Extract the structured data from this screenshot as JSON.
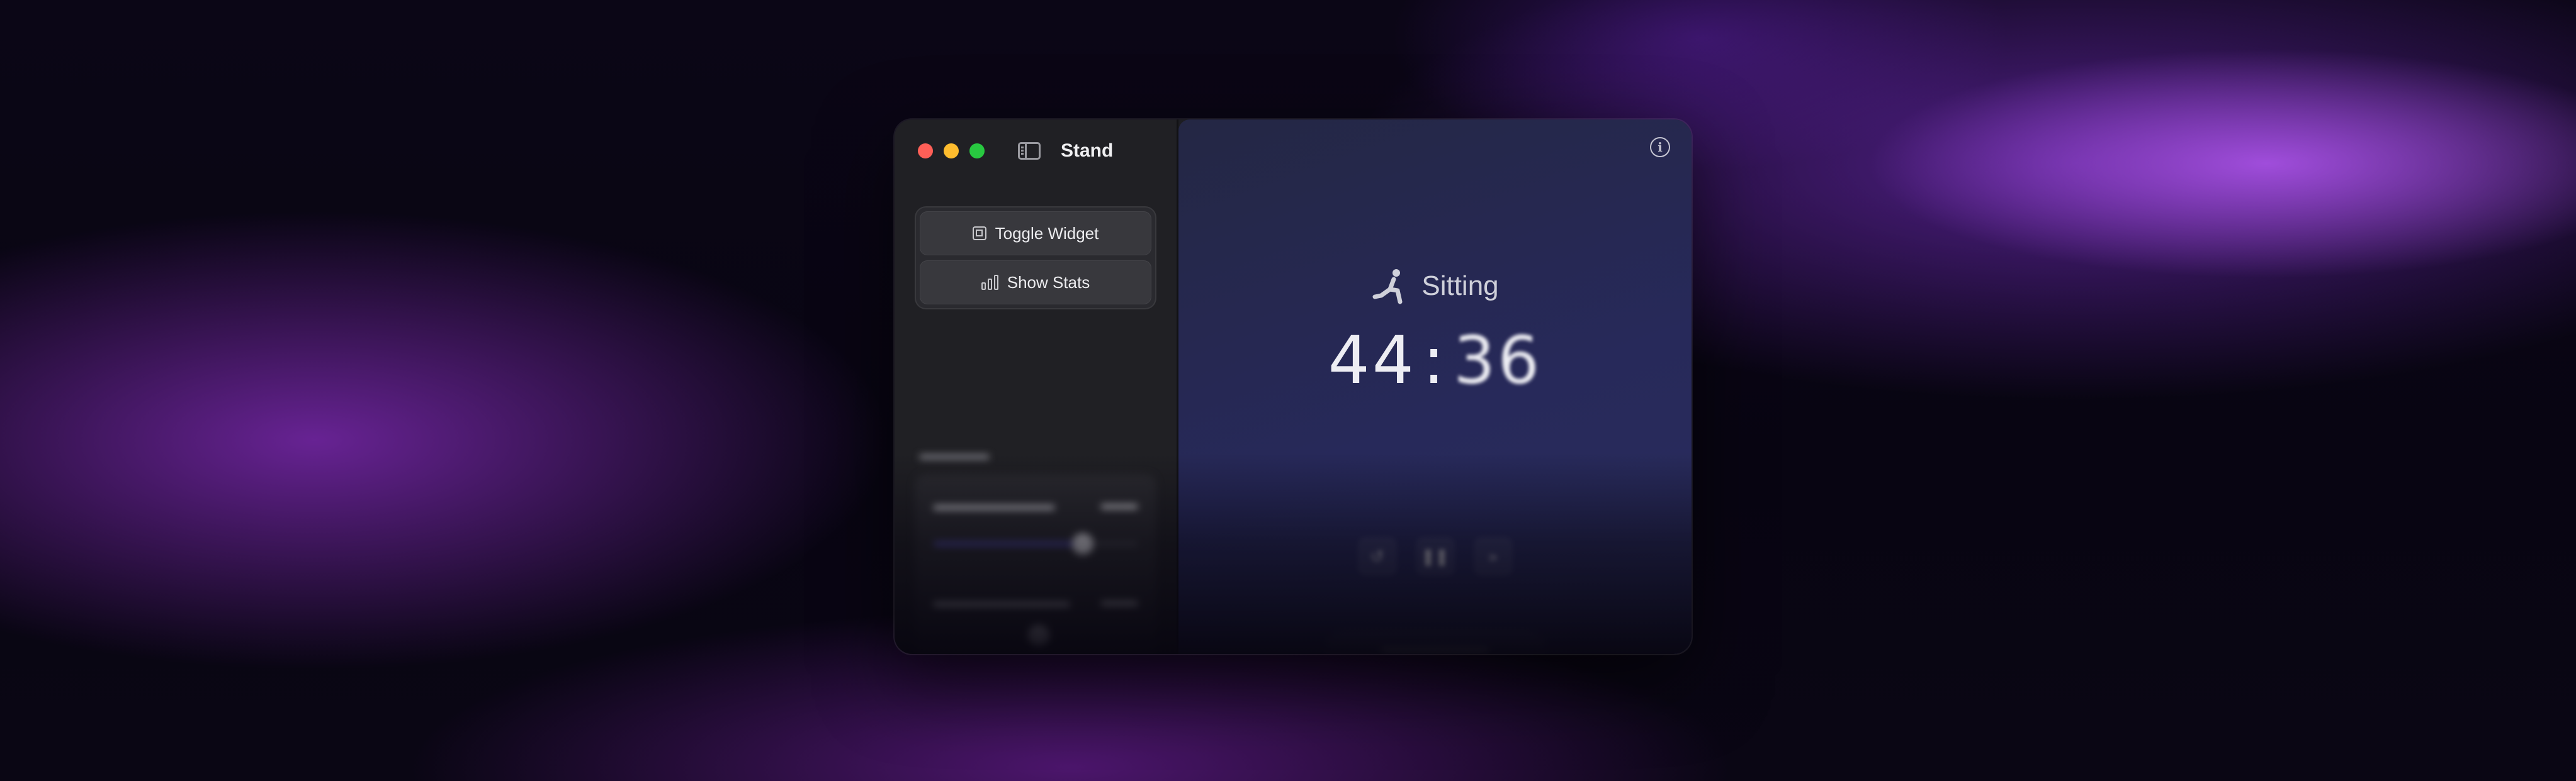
{
  "window": {
    "title": "Stand"
  },
  "sidebar": {
    "actions": [
      {
        "label": "Toggle Widget",
        "icon": "widget-icon"
      },
      {
        "label": "Show Stats",
        "icon": "chart-bar-icon"
      }
    ]
  },
  "main": {
    "status_label": "Sitting",
    "status_icon": "sitting-person-icon",
    "timer": {
      "minutes": "44",
      "separator": ":",
      "seconds": "36"
    }
  },
  "colors": {
    "accent": "#5b55c8",
    "main_panel": "#27295a",
    "sidebar": "#202024",
    "traffic_close": "#ff5f57",
    "traffic_minimize": "#febc2e",
    "traffic_maximize": "#28c840"
  }
}
